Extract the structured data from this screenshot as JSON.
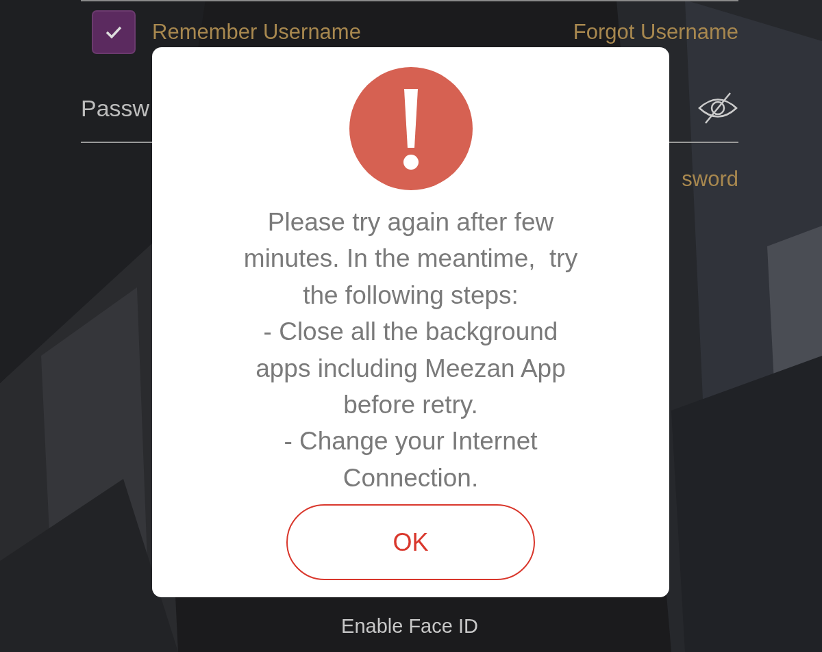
{
  "login": {
    "remember_username": {
      "label": "Remember Username",
      "checked": true
    },
    "forgot_username": "Forgot Username",
    "password": {
      "placeholder": "Passw"
    },
    "forgot_password": "sword",
    "enable_face_id": "Enable Face ID"
  },
  "alert": {
    "message": [
      "Please try again after few",
      "minutes. In the meantime,  try",
      "the following steps:",
      "- Close all the background",
      "apps including Meezan App",
      "before retry.",
      "- Change your Internet",
      "Connection."
    ],
    "button": "OK"
  }
}
